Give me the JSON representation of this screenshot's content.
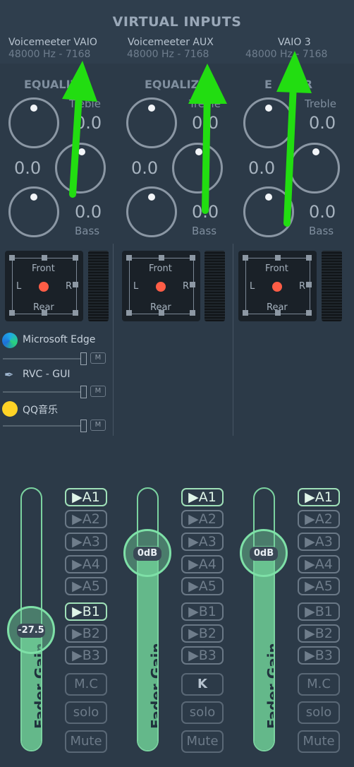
{
  "section_title": "VIRTUAL INPUTS",
  "strips": [
    {
      "name": "Voicemeeter VAIO",
      "rate": "48000 Hz - 7168",
      "eq_title": "EQUALIZ",
      "treble_label": "Treble",
      "bass_label": "Bass",
      "treble_value": "0.0",
      "mid_value": "0.0",
      "bass_value": "0.0",
      "pan_front": "Front",
      "pan_rear": "Rear",
      "pan_l": "L",
      "pan_r": "R",
      "fader_value": "-27.5",
      "fader_label": "Fader Gain",
      "fader_level": 0.45,
      "ctl_mc": "M.C",
      "ctl_solo": "solo",
      "ctl_mute": "Mute",
      "buses": [
        {
          "label": "▶A1",
          "on": true
        },
        {
          "label": "▶A2",
          "on": false
        },
        {
          "label": "▶A3",
          "on": false
        },
        {
          "label": "▶A4",
          "on": false
        },
        {
          "label": "▶A5",
          "on": false
        },
        {
          "label": "▶B1",
          "on": true
        },
        {
          "label": "▶B2",
          "on": false
        },
        {
          "label": "▶B3",
          "on": false
        }
      ]
    },
    {
      "name": "Voicemeeter AUX",
      "rate": "48000 Hz - 7168",
      "eq_title": "EQUALIZE",
      "treble_label": "Treble",
      "bass_label": "Bass",
      "treble_value": "0.0",
      "mid_value": "0.0",
      "bass_value": "0.0",
      "pan_front": "Front",
      "pan_rear": "Rear",
      "pan_l": "L",
      "pan_r": "R",
      "fader_value": "0dB",
      "fader_label": "Fader Gain",
      "fader_level": 0.78,
      "ctl_mc": "K",
      "ctl_solo": "solo",
      "ctl_mute": "Mute",
      "buses": [
        {
          "label": "▶A1",
          "on": true
        },
        {
          "label": "▶A2",
          "on": false
        },
        {
          "label": "▶A3",
          "on": false
        },
        {
          "label": "▶A4",
          "on": false
        },
        {
          "label": "▶A5",
          "on": false
        },
        {
          "label": "▶B1",
          "on": false
        },
        {
          "label": "▶B2",
          "on": false
        },
        {
          "label": "▶B3",
          "on": false
        }
      ]
    },
    {
      "name": "VAIO 3",
      "rate": "48000 Hz - 7168",
      "eq_title": "E    ZER",
      "treble_label": "Treble",
      "bass_label": "Bass",
      "treble_value": "0.0",
      "mid_value": "0.0",
      "bass_value": "0.0",
      "pan_front": "Front",
      "pan_rear": "Rear",
      "pan_l": "L",
      "pan_r": "R",
      "fader_value": "0dB",
      "fader_label": "Fader Gain",
      "fader_level": 0.78,
      "ctl_mc": "M.C",
      "ctl_solo": "solo",
      "ctl_mute": "Mute",
      "buses": [
        {
          "label": "▶A1",
          "on": true
        },
        {
          "label": "▶A2",
          "on": false
        },
        {
          "label": "▶A3",
          "on": false
        },
        {
          "label": "▶A4",
          "on": false
        },
        {
          "label": "▶A5",
          "on": false
        },
        {
          "label": "▶B1",
          "on": false
        },
        {
          "label": "▶B2",
          "on": false
        },
        {
          "label": "▶B3",
          "on": false
        }
      ]
    }
  ],
  "apps": [
    {
      "name": "Microsoft Edge",
      "icon": "edge-icon",
      "mute": "M"
    },
    {
      "name": "RVC - GUI",
      "icon": "feather-icon",
      "mute": "M"
    },
    {
      "name": "QQ音乐",
      "icon": "qq-music-icon",
      "mute": "M"
    }
  ],
  "colors": {
    "background": "#2c3a48",
    "fader_green": "#6fcf97",
    "bus_active": "#9fe0b8",
    "pan_dot": "#ff5d46",
    "annotation_arrow": "#22dd11"
  }
}
